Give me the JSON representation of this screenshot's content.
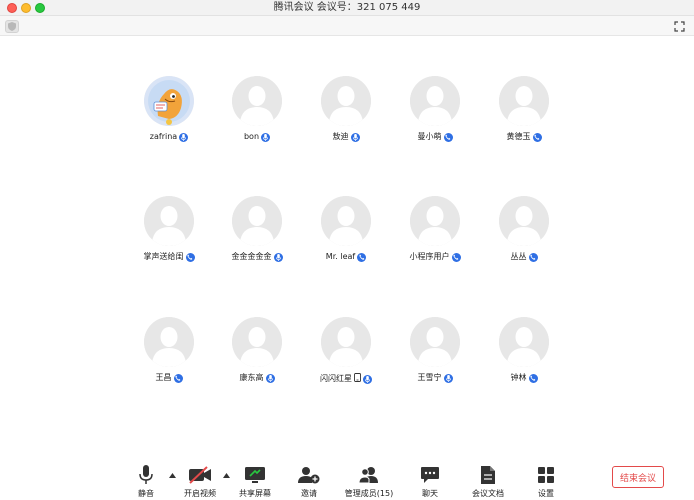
{
  "window": {
    "title": "腾讯会议 会议号：321 075 449"
  },
  "toolbar": {
    "shield_icon": "shield-icon",
    "fullscreen_icon": "fullscreen-icon"
  },
  "participants": [
    {
      "name": "zafrina",
      "avatar": "custom-cartoon",
      "mic_icon": "mic-icon"
    },
    {
      "name": "bon",
      "avatar": "default",
      "mic_icon": "mic-icon"
    },
    {
      "name": "敖迪",
      "avatar": "default",
      "mic_icon": "mic-icon"
    },
    {
      "name": "曼小萌",
      "avatar": "default",
      "mic_icon": "phone-icon"
    },
    {
      "name": "黄德玉",
      "avatar": "default",
      "mic_icon": "phone-icon"
    },
    {
      "name": "掌声送给闺",
      "avatar": "default",
      "mic_icon": "phone-icon"
    },
    {
      "name": "金金金金金",
      "avatar": "default",
      "mic_icon": "mic-icon"
    },
    {
      "name": "Mr. leaf",
      "avatar": "default",
      "mic_icon": "phone-icon"
    },
    {
      "name": "小程序用户",
      "avatar": "default",
      "mic_icon": "phone-icon"
    },
    {
      "name": "丛丛",
      "avatar": "default",
      "mic_icon": "phone-icon"
    },
    {
      "name": "王昌",
      "avatar": "default",
      "mic_icon": "phone-icon"
    },
    {
      "name": "康东高",
      "avatar": "default",
      "mic_icon": "mic-icon"
    },
    {
      "name": "闪闪红星",
      "avatar": "default",
      "mic_icon": "mic-icon",
      "extra_icon": "mobile-icon"
    },
    {
      "name": "王雪宁",
      "avatar": "default",
      "mic_icon": "mic-icon"
    },
    {
      "name": "钟林",
      "avatar": "default",
      "mic_icon": "phone-icon"
    }
  ],
  "bottom_bar": {
    "mute": {
      "label": "静音",
      "icon": "microphone-icon"
    },
    "video": {
      "label": "开启视频",
      "icon": "camera-off-icon"
    },
    "share": {
      "label": "共享屏幕",
      "icon": "share-screen-icon"
    },
    "invite": {
      "label": "邀请",
      "icon": "add-user-icon"
    },
    "members": {
      "label": "管理成员(15)",
      "icon": "members-icon"
    },
    "chat": {
      "label": "聊天",
      "icon": "chat-icon"
    },
    "docs": {
      "label": "会议文档",
      "icon": "document-icon"
    },
    "settings": {
      "label": "设置",
      "icon": "settings-grid-icon"
    },
    "end": {
      "label": "结束会议"
    }
  },
  "colors": {
    "accent": "#2f6fe4",
    "danger": "#e34a4a",
    "avatar_bg": "#e7e7e7",
    "avatar_fg": "#ffffff"
  }
}
